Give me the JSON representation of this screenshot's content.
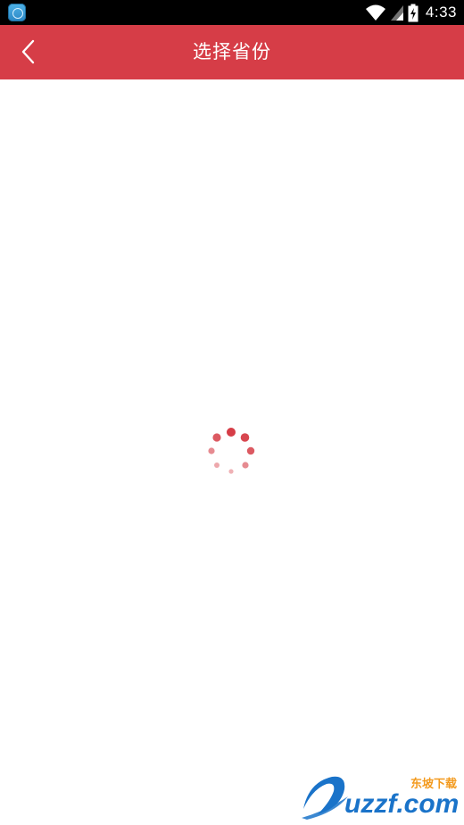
{
  "status_bar": {
    "time": "4:33",
    "icons": [
      "app-notification-icon",
      "wifi-icon",
      "signal-icon",
      "battery-charging-icon"
    ]
  },
  "header": {
    "title": "选择省份",
    "back_icon": "chevron-left-icon"
  },
  "content": {
    "state": "loading",
    "spinner_icon": "loading-spinner-icon"
  },
  "watermark": {
    "brand": "uzzf.com",
    "tagline": "东坡下载"
  },
  "colors": {
    "header_background": "#d63d47",
    "status_bar_background": "#000000",
    "spinner": "#d63d47",
    "watermark_blue": "#1a73c9",
    "watermark_orange": "#f39a1e"
  }
}
